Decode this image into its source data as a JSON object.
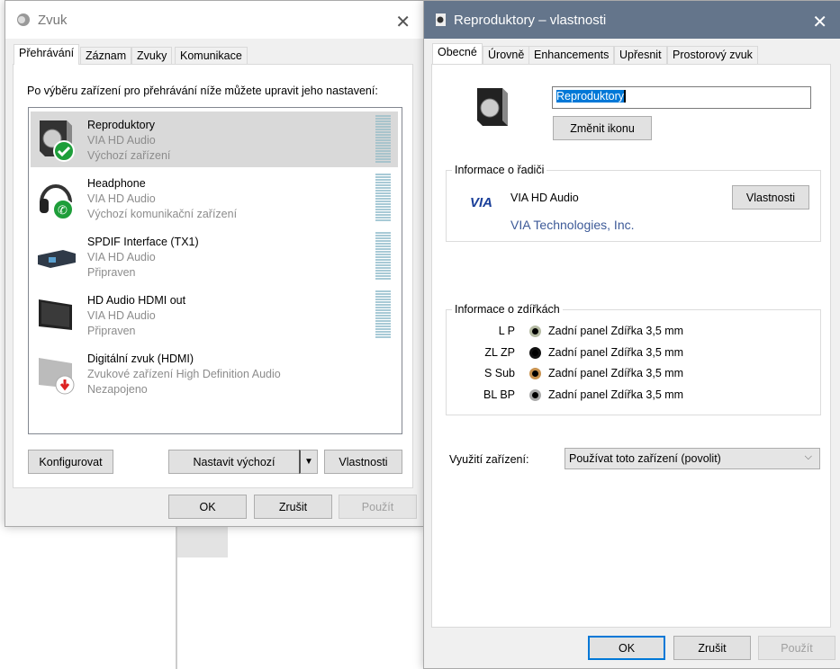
{
  "sound_dialog": {
    "title": "Zvuk",
    "tabs": [
      "Přehrávání",
      "Záznam",
      "Zvuky",
      "Komunikace"
    ],
    "instruction": "Po výběru zařízení pro přehrávání níže můžete upravit jeho nastavení:",
    "devices": [
      {
        "name": "Reproduktory",
        "driver": "VIA HD Audio",
        "status": "Výchozí zařízení",
        "icon": "speaker-icon",
        "badge": "default-check-icon",
        "selected": true
      },
      {
        "name": "Headphone",
        "driver": "VIA HD Audio",
        "status": "Výchozí komunikační zařízení",
        "icon": "headphone-icon",
        "badge": "phone-badge-icon"
      },
      {
        "name": "SPDIF Interface (TX1)",
        "driver": "VIA HD Audio",
        "status": "Připraven",
        "icon": "spdif-device-icon"
      },
      {
        "name": "HD Audio HDMI out",
        "driver": "VIA HD Audio",
        "status": "Připraven",
        "icon": "monitor-icon"
      },
      {
        "name": "Digitální zvuk (HDMI)",
        "driver": "Zvukové zařízení High Definition Audio",
        "status": "Nezapojeno",
        "icon": "monitor-disconnected-icon"
      }
    ],
    "buttons": {
      "configure": "Konfigurovat",
      "set_default": "Nastavit výchozí",
      "properties": "Vlastnosti",
      "ok": "OK",
      "cancel": "Zrušit",
      "apply": "Použít"
    }
  },
  "properties_dialog": {
    "title": "Reproduktory – vlastnosti",
    "tabs": [
      "Obecné",
      "Úrovně",
      "Enhancements",
      "Upřesnit",
      "Prostorový zvuk"
    ],
    "name_value": "Reproduktory",
    "change_icon": "Změnit ikonu",
    "controller": {
      "label": "Informace o řadiči",
      "name": "VIA HD Audio",
      "vendor": "VIA Technologies, Inc.",
      "properties": "Vlastnosti",
      "logo": "VIA"
    },
    "jacks": {
      "label": "Informace o zdířkách",
      "rows": [
        {
          "channels": "L P",
          "desc": "Zadní panel Zdířka 3,5 mm",
          "color": "#b5bba3"
        },
        {
          "channels": "ZL ZP",
          "desc": "Zadní panel Zdířka 3,5 mm",
          "color": "#111111"
        },
        {
          "channels": "S Sub",
          "desc": "Zadní panel Zdířka 3,5 mm",
          "color": "#c8924f"
        },
        {
          "channels": "BL BP",
          "desc": "Zadní panel Zdířka 3,5 mm",
          "color": "#aaaaaa"
        }
      ]
    },
    "usage": {
      "label": "Využití zařízení:",
      "value": "Používat toto zařízení (povolit)"
    },
    "buttons": {
      "ok": "OK",
      "cancel": "Zrušit",
      "apply": "Použít"
    }
  }
}
